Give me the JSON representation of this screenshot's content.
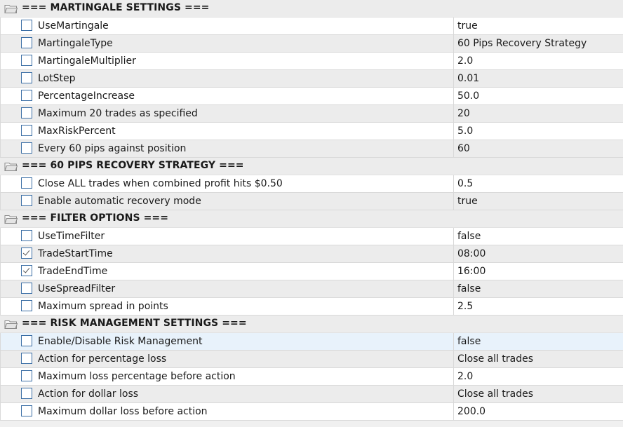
{
  "rows": [
    {
      "type": "section",
      "title": "=== MARTINGALE SETTINGS ==="
    },
    {
      "type": "item",
      "label": "UseMartingale",
      "value": "true",
      "checked": false
    },
    {
      "type": "item",
      "label": "MartingaleType",
      "value": "60 Pips Recovery Strategy",
      "checked": false
    },
    {
      "type": "item",
      "label": "MartingaleMultiplier",
      "value": "2.0",
      "checked": false
    },
    {
      "type": "item",
      "label": "LotStep",
      "value": "0.01",
      "checked": false
    },
    {
      "type": "item",
      "label": "PercentageIncrease",
      "value": "50.0",
      "checked": false
    },
    {
      "type": "item",
      "label": "Maximum 20 trades as specified",
      "value": "20",
      "checked": false
    },
    {
      "type": "item",
      "label": "MaxRiskPercent",
      "value": "5.0",
      "checked": false
    },
    {
      "type": "item",
      "label": "Every 60 pips against position",
      "value": "60",
      "checked": false
    },
    {
      "type": "section",
      "title": "=== 60 PIPS RECOVERY STRATEGY ==="
    },
    {
      "type": "item",
      "label": "Close ALL trades when combined profit hits $0.50",
      "value": "0.5",
      "checked": false
    },
    {
      "type": "item",
      "label": "Enable automatic recovery mode",
      "value": "true",
      "checked": false
    },
    {
      "type": "section",
      "title": "=== FILTER OPTIONS ==="
    },
    {
      "type": "item",
      "label": "UseTimeFilter",
      "value": "false",
      "checked": false
    },
    {
      "type": "item",
      "label": "TradeStartTime",
      "value": "08:00",
      "checked": true
    },
    {
      "type": "item",
      "label": "TradeEndTime",
      "value": "16:00",
      "checked": true
    },
    {
      "type": "item",
      "label": "UseSpreadFilter",
      "value": "false",
      "checked": false
    },
    {
      "type": "item",
      "label": "Maximum spread in points",
      "value": "2.5",
      "checked": false
    },
    {
      "type": "section",
      "title": "=== RISK MANAGEMENT SETTINGS ==="
    },
    {
      "type": "item",
      "label": "Enable/Disable Risk Management",
      "value": "false",
      "checked": false,
      "selected": true
    },
    {
      "type": "item",
      "label": "Action for percentage loss",
      "value": "Close all trades",
      "checked": false
    },
    {
      "type": "item",
      "label": "Maximum loss percentage before action",
      "value": "2.0",
      "checked": false
    },
    {
      "type": "item",
      "label": "Action for dollar loss",
      "value": "Close all trades",
      "checked": false
    },
    {
      "type": "item",
      "label": "Maximum dollar loss before action",
      "value": "200.0",
      "checked": false
    }
  ],
  "colors": {
    "section_bg": "#ececec",
    "row_white": "#ffffff",
    "row_alt": "#ececec",
    "row_selected": "#e8f2fb",
    "checkbox_border": "#3b6ea5"
  },
  "icons": {
    "section": "folder-icon"
  }
}
